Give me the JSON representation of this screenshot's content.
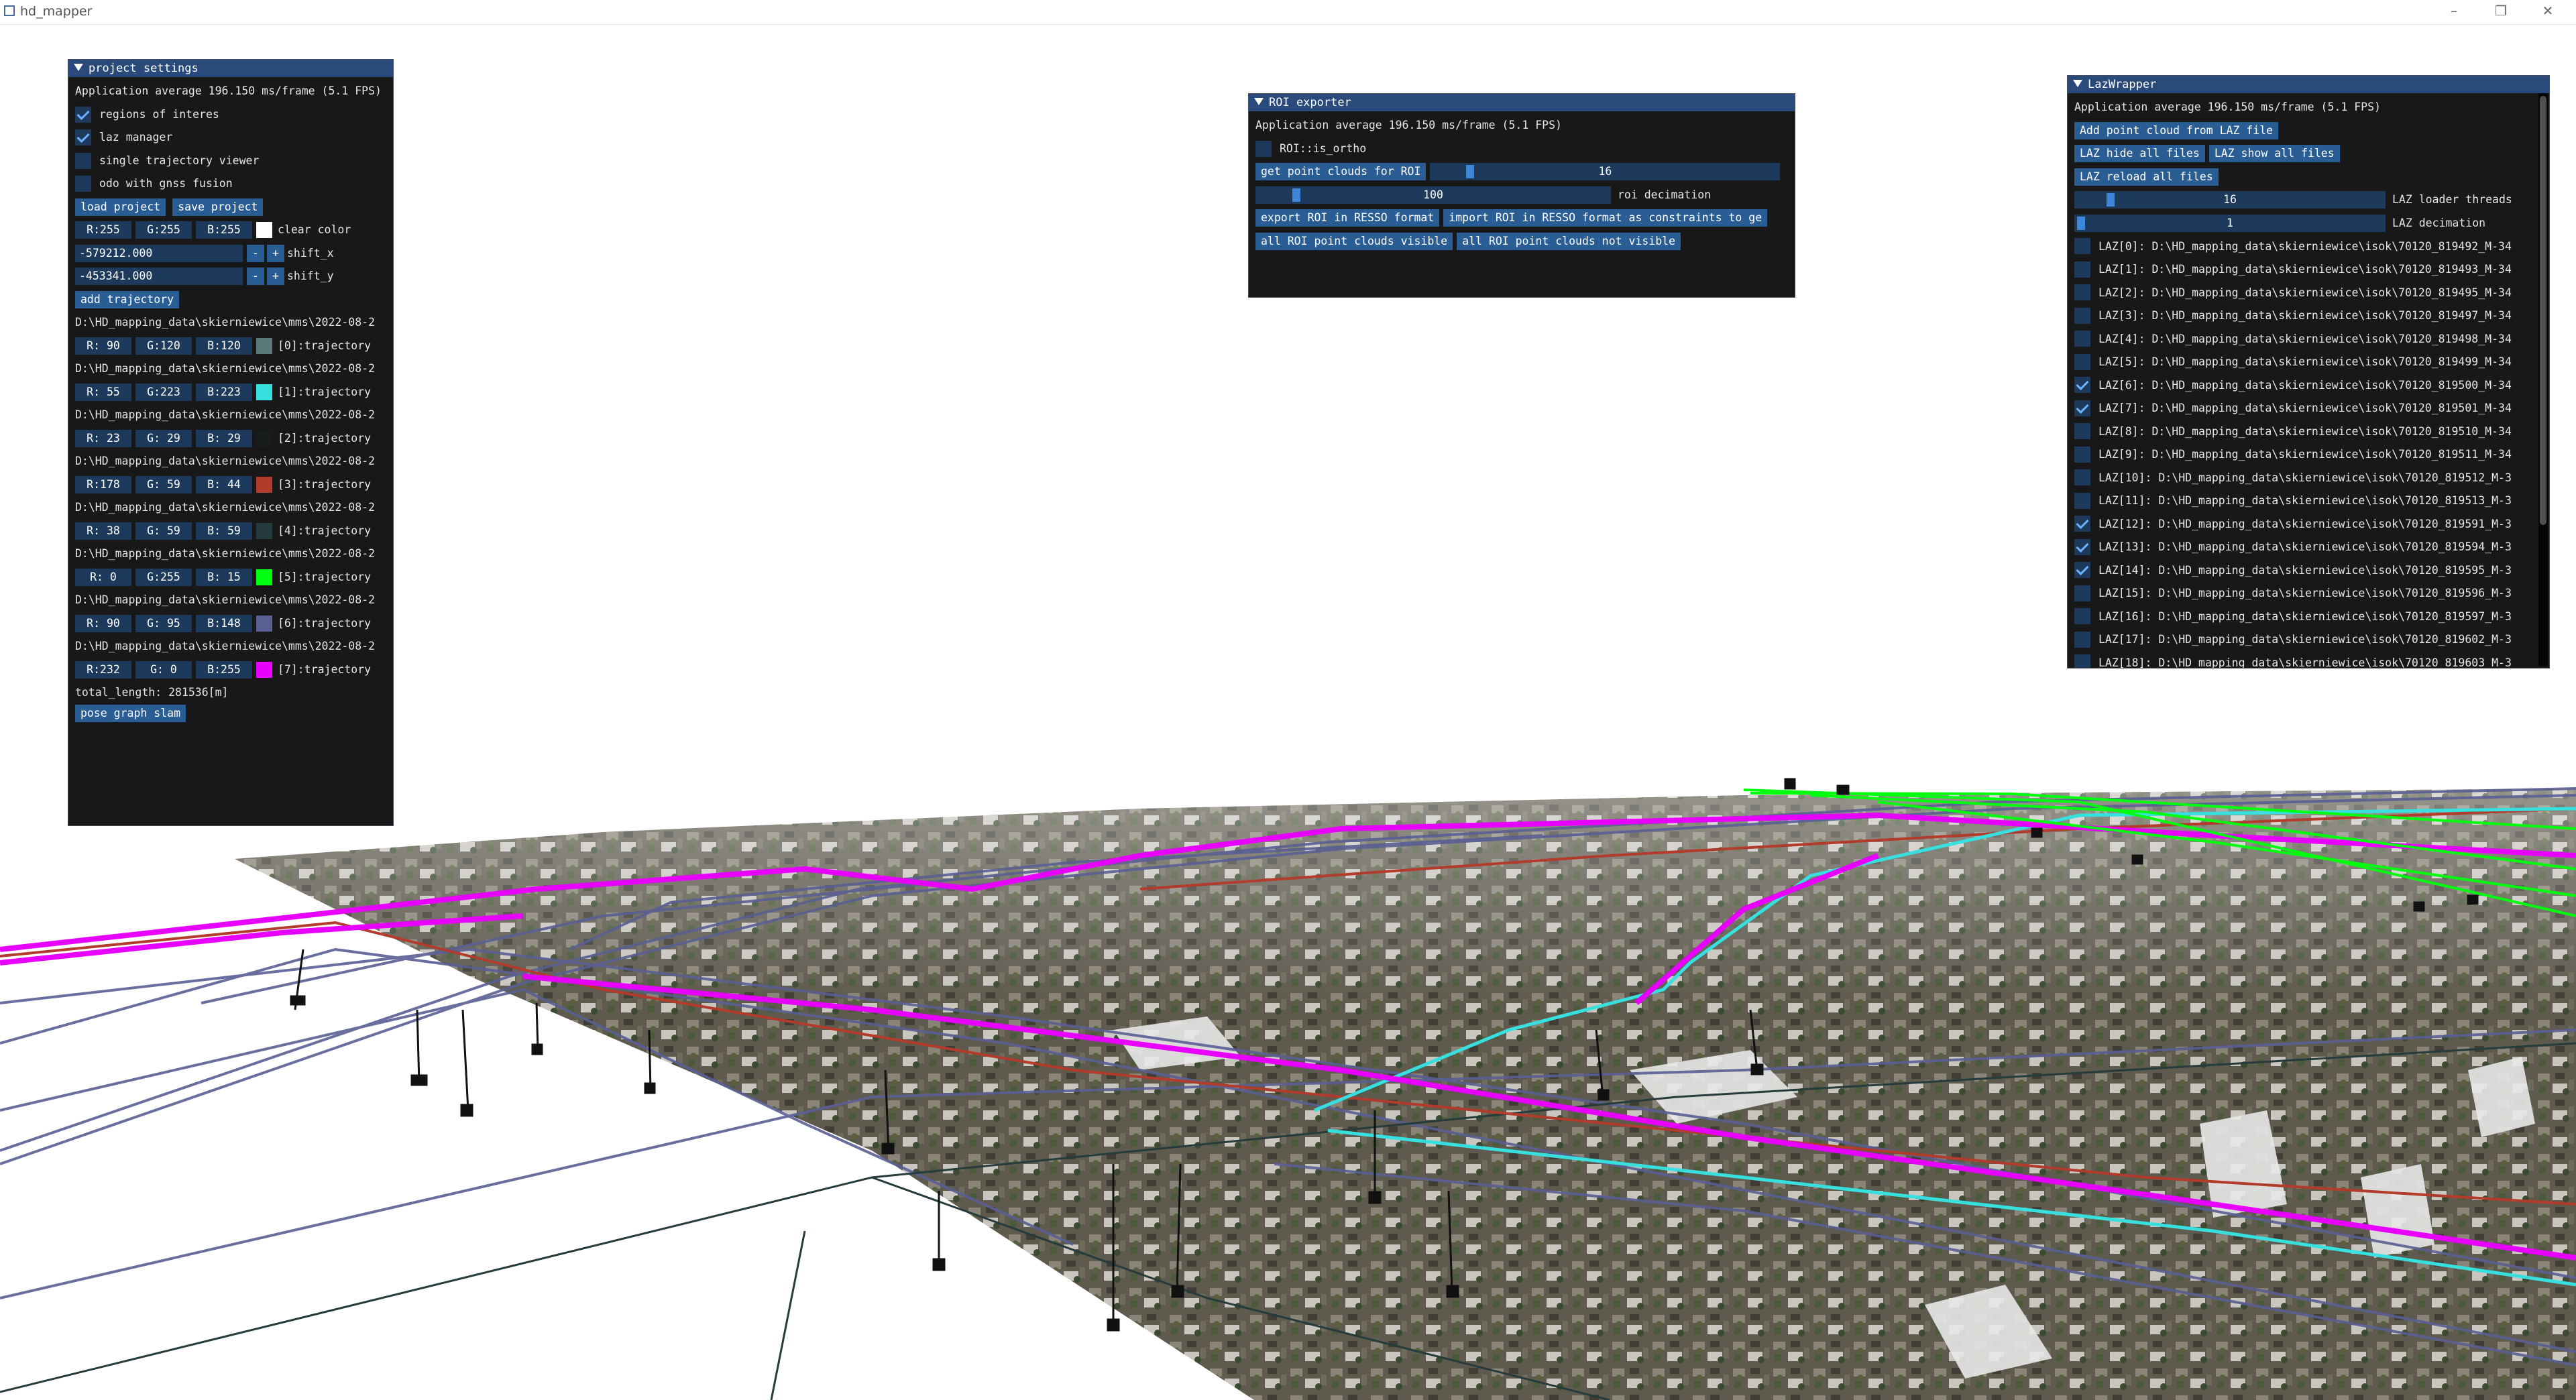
{
  "window": {
    "title": "hd_mapper",
    "minimize": "–",
    "restore": "❐",
    "close": "✕"
  },
  "project_settings": {
    "title": "project settings",
    "fps": "Application average 196.150 ms/frame (5.1 FPS)",
    "checkboxes": [
      {
        "label": "regions of interes",
        "checked": true
      },
      {
        "label": "laz manager",
        "checked": true
      },
      {
        "label": "single trajectory viewer",
        "checked": false
      },
      {
        "label": "odo with gnss fusion",
        "checked": false
      }
    ],
    "load_project": "load project",
    "save_project": "save project",
    "clear_color": {
      "r": "R:255",
      "g": "G:255",
      "b": "B:255",
      "swatch": "#ffffff",
      "label": "clear color"
    },
    "shift_x": {
      "value": "-579212.000",
      "minus": "-",
      "plus": "+",
      "label": "shift_x"
    },
    "shift_y": {
      "value": "-453341.000",
      "minus": "-",
      "plus": "+",
      "label": "shift_y"
    },
    "add_trajectory": "add trajectory",
    "trajectories": [
      {
        "path": "D:\\HD_mapping_data\\skierniewice\\mms\\2022-08-2",
        "r": "R: 90",
        "g": "G:120",
        "b": "B:120",
        "color": "#5a7878",
        "label": "[0]:trajectory"
      },
      {
        "path": "D:\\HD_mapping_data\\skierniewice\\mms\\2022-08-2",
        "r": "R: 55",
        "g": "G:223",
        "b": "B:223",
        "color": "#37dfdf",
        "label": "[1]:trajectory"
      },
      {
        "path": "D:\\HD_mapping_data\\skierniewice\\mms\\2022-08-2",
        "r": "R: 23",
        "g": "G: 29",
        "b": "B: 29",
        "color": "#171d1d",
        "label": "[2]:trajectory"
      },
      {
        "path": "D:\\HD_mapping_data\\skierniewice\\mms\\2022-08-2",
        "r": "R:178",
        "g": "G: 59",
        "b": "B: 44",
        "color": "#b23b2c",
        "label": "[3]:trajectory"
      },
      {
        "path": "D:\\HD_mapping_data\\skierniewice\\mms\\2022-08-2",
        "r": "R: 38",
        "g": "G: 59",
        "b": "B: 59",
        "color": "#263b3b",
        "label": "[4]:trajectory"
      },
      {
        "path": "D:\\HD_mapping_data\\skierniewice\\mms\\2022-08-2",
        "r": "R:  0",
        "g": "G:255",
        "b": "B: 15",
        "color": "#00ff0f",
        "label": "[5]:trajectory"
      },
      {
        "path": "D:\\HD_mapping_data\\skierniewice\\mms\\2022-08-2",
        "r": "R: 90",
        "g": "G: 95",
        "b": "B:148",
        "color": "#5a5f94",
        "label": "[6]:trajectory"
      },
      {
        "path": "D:\\HD_mapping_data\\skierniewice\\mms\\2022-08-2",
        "r": "R:232",
        "g": "G:  0",
        "b": "B:255",
        "color": "#e800ff",
        "label": "[7]:trajectory"
      }
    ],
    "total_length": "total_length: 281536[m]",
    "pose_graph_slam": "pose graph slam"
  },
  "roi_exporter": {
    "title": "ROI exporter",
    "fps": "Application average 196.150 ms/frame (5.1 FPS)",
    "is_ortho": {
      "label": "ROI::is_ortho",
      "checked": false
    },
    "get_point_clouds": "get point clouds for ROI",
    "slider1": {
      "value": "16",
      "fraction": 0.1
    },
    "slider2": {
      "value": "100",
      "label": "roi decimation",
      "fraction": 0.1
    },
    "export_resso": "export ROI in RESSO format",
    "import_resso": "import ROI in RESSO format as constraints to ge",
    "all_visible": "all ROI point clouds visible",
    "all_not_visible": "all ROI point clouds not visible"
  },
  "laz_wrapper": {
    "title": "LazWrapper",
    "fps": "Application average 196.150 ms/frame (5.1 FPS)",
    "add_point_cloud": "Add point cloud from LAZ file",
    "hide_all": "LAZ hide all files",
    "show_all": "LAZ show all files",
    "reload_all": "LAZ reload all files",
    "loader_threads": {
      "value": "16",
      "label": "LAZ loader threads",
      "fraction": 0.1
    },
    "decimation": {
      "value": "1",
      "label": "LAZ decimation",
      "fraction": 0.0
    },
    "files": [
      {
        "label": "LAZ[0]: D:\\HD_mapping_data\\skierniewice\\isok\\70120_819492_M-34",
        "checked": false
      },
      {
        "label": "LAZ[1]: D:\\HD_mapping_data\\skierniewice\\isok\\70120_819493_M-34",
        "checked": false
      },
      {
        "label": "LAZ[2]: D:\\HD_mapping_data\\skierniewice\\isok\\70120_819495_M-34",
        "checked": false
      },
      {
        "label": "LAZ[3]: D:\\HD_mapping_data\\skierniewice\\isok\\70120_819497_M-34",
        "checked": false
      },
      {
        "label": "LAZ[4]: D:\\HD_mapping_data\\skierniewice\\isok\\70120_819498_M-34",
        "checked": false
      },
      {
        "label": "LAZ[5]: D:\\HD_mapping_data\\skierniewice\\isok\\70120_819499_M-34",
        "checked": false
      },
      {
        "label": "LAZ[6]: D:\\HD_mapping_data\\skierniewice\\isok\\70120_819500_M-34",
        "checked": true
      },
      {
        "label": "LAZ[7]: D:\\HD_mapping_data\\skierniewice\\isok\\70120_819501_M-34",
        "checked": true
      },
      {
        "label": "LAZ[8]: D:\\HD_mapping_data\\skierniewice\\isok\\70120_819510_M-34",
        "checked": false
      },
      {
        "label": "LAZ[9]: D:\\HD_mapping_data\\skierniewice\\isok\\70120_819511_M-34",
        "checked": false
      },
      {
        "label": "LAZ[10]: D:\\HD_mapping_data\\skierniewice\\isok\\70120_819512_M-3",
        "checked": false
      },
      {
        "label": "LAZ[11]: D:\\HD_mapping_data\\skierniewice\\isok\\70120_819513_M-3",
        "checked": false
      },
      {
        "label": "LAZ[12]: D:\\HD_mapping_data\\skierniewice\\isok\\70120_819591_M-3",
        "checked": true
      },
      {
        "label": "LAZ[13]: D:\\HD_mapping_data\\skierniewice\\isok\\70120_819594_M-3",
        "checked": true
      },
      {
        "label": "LAZ[14]: D:\\HD_mapping_data\\skierniewice\\isok\\70120_819595_M-3",
        "checked": true
      },
      {
        "label": "LAZ[15]: D:\\HD_mapping_data\\skierniewice\\isok\\70120_819596_M-3",
        "checked": false
      },
      {
        "label": "LAZ[16]: D:\\HD_mapping_data\\skierniewice\\isok\\70120_819597_M-3",
        "checked": false
      },
      {
        "label": "LAZ[17]: D:\\HD_mapping_data\\skierniewice\\isok\\70120_819602_M-3",
        "checked": false
      },
      {
        "label": "LAZ[18]: D:\\HD_mapping_data\\skierniewice\\isok\\70120_819603_M-3",
        "checked": false
      }
    ]
  },
  "colors": {
    "imgui_bg": "#0a0a0a",
    "imgui_header": "#294a7a",
    "imgui_button": "#295d94",
    "imgui_frame": "#1d3a5c",
    "traj_magenta": "#e800ff",
    "traj_cyan": "#37dfdf",
    "traj_green": "#00ff0f",
    "traj_blue": "#5a5f94",
    "traj_red": "#b23b2c"
  }
}
